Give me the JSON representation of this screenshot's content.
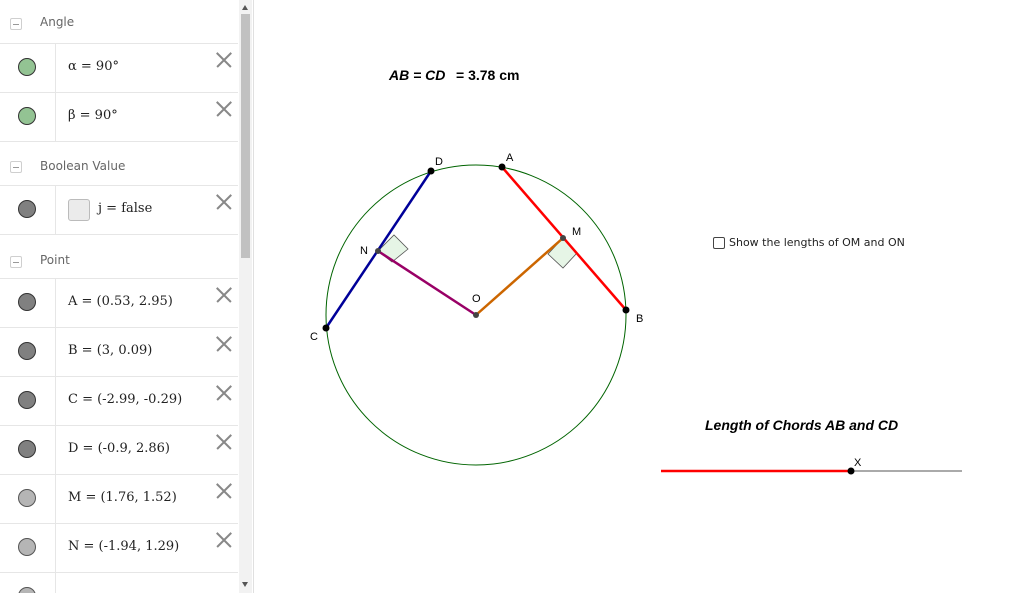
{
  "algebra": {
    "sections": [
      {
        "key": "angle",
        "label": "Angle"
      },
      {
        "key": "boolean",
        "label": "Boolean Value"
      },
      {
        "key": "point",
        "label": "Point"
      }
    ],
    "rows": [
      {
        "text": "α = 90°",
        "color": "#93c393"
      },
      {
        "text": "β = 90°",
        "color": "#93c393"
      },
      {
        "text": "j = false",
        "color": "#808080"
      },
      {
        "text": "A = (0.53, 2.95)",
        "color": "#808080"
      },
      {
        "text": "B = (3, 0.09)",
        "color": "#808080"
      },
      {
        "text": "C = (-2.99, -0.29)",
        "color": "#808080"
      },
      {
        "text": "D = (-0.9, 2.86)",
        "color": "#808080"
      },
      {
        "text": "M = (1.76, 1.52)",
        "color": "#b5b5b5"
      },
      {
        "text": "N = (-1.94, 1.29)",
        "color": "#b5b5b5"
      }
    ]
  },
  "graphics": {
    "equation": {
      "lhs": "AB = CD",
      "rhs": "= 3.78 cm"
    },
    "checkbox_label": "Show the lengths of OM and ON",
    "slider_title": "Length of Chords AB and CD",
    "point_labels": {
      "A": "A",
      "B": "B",
      "C": "C",
      "D": "D",
      "M": "M",
      "N": "N",
      "O": "O",
      "X": "X"
    },
    "colors": {
      "circle": "#006400",
      "chord_ab": "#ff0000",
      "chord_cd": "#000099",
      "om": "#cc6600",
      "on": "#990066",
      "right_angle_fill": "#e6f5e6"
    }
  }
}
